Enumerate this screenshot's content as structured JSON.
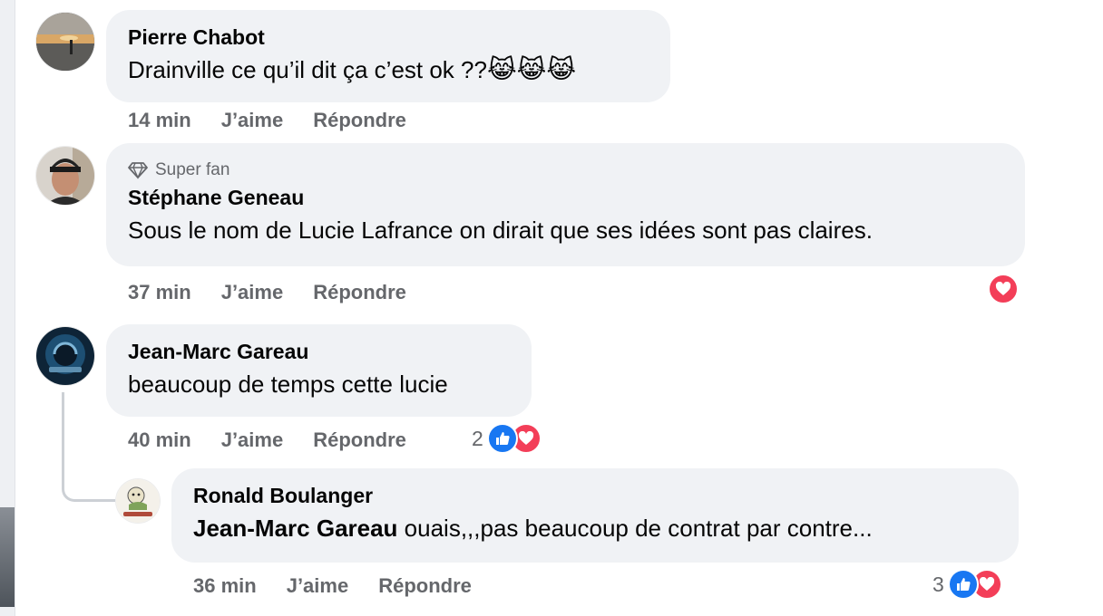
{
  "comments": [
    {
      "author": "Pierre Chabot",
      "text": "Drainville ce qu’il dit ça c’est ok ??",
      "emoji": "😹😹😹",
      "time": "14 min",
      "like_label": "J’aime",
      "reply_label": "Répondre"
    },
    {
      "badge": "Super fan",
      "author": "Stéphane Geneau",
      "text": "Sous le nom de Lucie Lafrance on dirait que ses idées sont pas claires.",
      "time": "37 min",
      "like_label": "J’aime",
      "reply_label": "Répondre",
      "reactions": [
        "love"
      ]
    },
    {
      "author": "Jean-Marc Gareau",
      "text": "beaucoup de temps cette lucie",
      "time": "40 min",
      "like_label": "J’aime",
      "reply_label": "Répondre",
      "reaction_count": "2",
      "reactions": [
        "like",
        "love"
      ]
    },
    {
      "author": "Ronald Boulanger",
      "mention": "Jean-Marc Gareau",
      "text": " ouais,,,pas beaucoup de contrat par contre...",
      "time": "36 min",
      "like_label": "J’aime",
      "reply_label": "Répondre",
      "reaction_count": "3",
      "reactions": [
        "like",
        "love"
      ]
    }
  ],
  "colors": {
    "bubble": "#f0f2f5",
    "meta_text": "#65676b",
    "like": "#1877f2",
    "love": "#f33e58",
    "thread_line": "#ccd0d5"
  }
}
